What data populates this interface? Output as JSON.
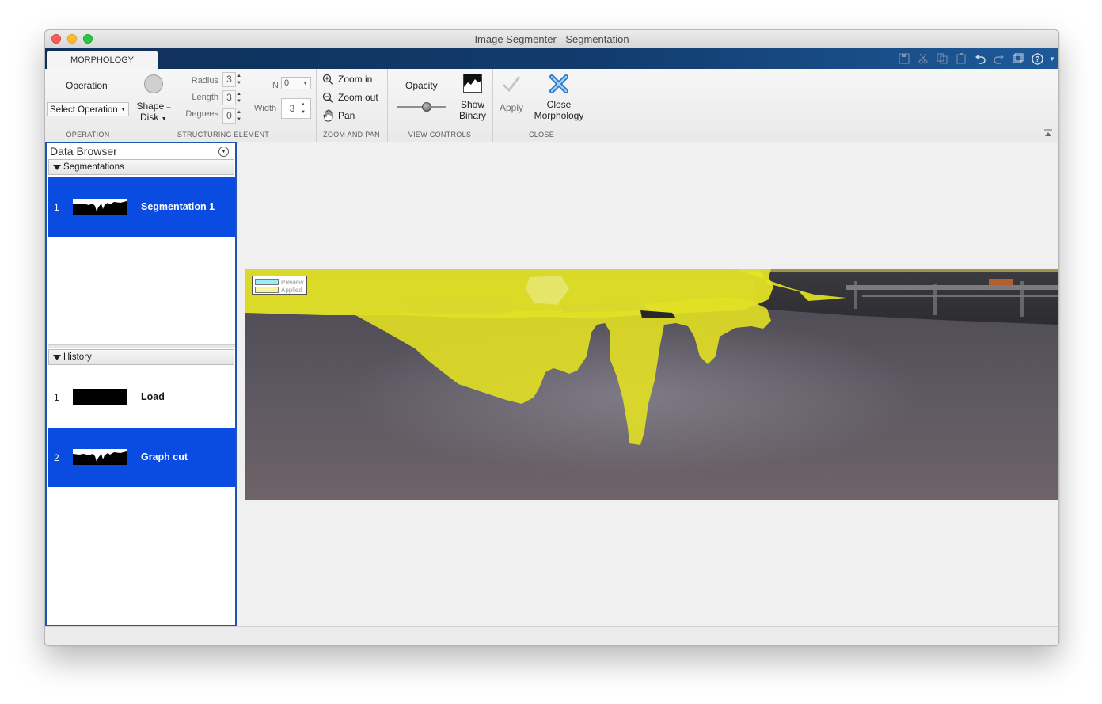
{
  "window": {
    "title": "Image Segmenter - Segmentation"
  },
  "tabs": [
    {
      "label": "MORPHOLOGY"
    }
  ],
  "ribbon": {
    "operation": {
      "heading": "Operation",
      "select_value": "Select Operation",
      "section_title": "OPERATION"
    },
    "structuring_element": {
      "shape_label_line1": "Shape",
      "shape_label_line2": "Disk",
      "radius_label": "Radius",
      "radius_value": "3",
      "length_label": "Length",
      "length_value": "3",
      "degrees_label": "Degrees",
      "degrees_value": "0",
      "n_label": "N",
      "n_value": "0",
      "width_label": "Width",
      "width_value": "3",
      "section_title": "STRUCTURING ELEMENT"
    },
    "zoom_pan": {
      "zoom_in": "Zoom in",
      "zoom_out": "Zoom out",
      "pan": "Pan",
      "section_title": "ZOOM AND PAN"
    },
    "view_controls": {
      "opacity_label": "Opacity",
      "opacity_level": 0.6,
      "show_binary_line1": "Show",
      "show_binary_line2": "Binary",
      "section_title": "VIEW CONTROLS"
    },
    "close": {
      "apply": "Apply",
      "close_line1": "Close",
      "close_line2": "Morphology",
      "section_title": "CLOSE"
    }
  },
  "data_browser": {
    "title": "Data Browser",
    "segmentations": {
      "header": "Segmentations",
      "items": [
        {
          "index": "1",
          "name": "Segmentation 1",
          "selected": true
        }
      ]
    },
    "history": {
      "header": "History",
      "items": [
        {
          "index": "1",
          "name": "Load",
          "selected": false
        },
        {
          "index": "2",
          "name": "Graph cut",
          "selected": true
        }
      ]
    }
  },
  "legend": {
    "preview": "Preview",
    "applied": "Applied"
  },
  "colors": {
    "selection": "#0a4be1",
    "overlay_applied": "#e8e81e",
    "overlay_preview": "#9eeaf7",
    "tabstrip": "#123c6e"
  }
}
